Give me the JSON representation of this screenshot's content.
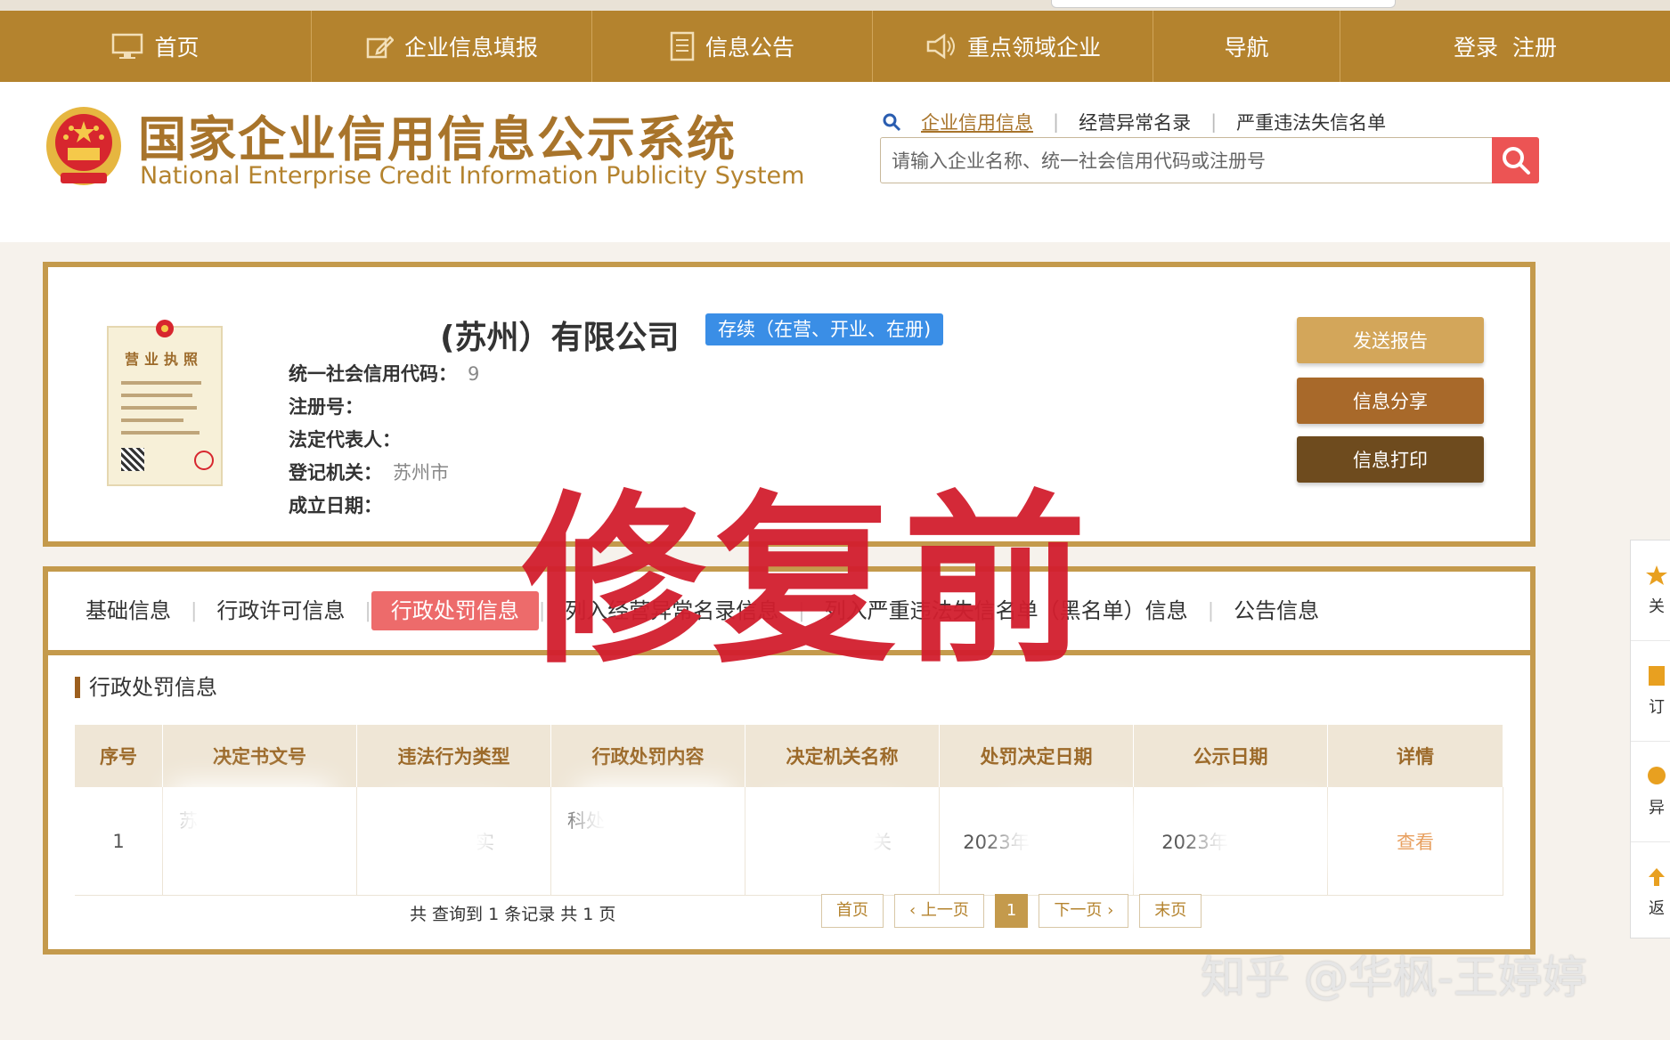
{
  "nav": {
    "items": [
      {
        "label": "首页",
        "icon": "monitor-icon"
      },
      {
        "label": "企业信息填报",
        "icon": "edit-icon"
      },
      {
        "label": "信息公告",
        "icon": "document-icon"
      },
      {
        "label": "重点领域企业",
        "icon": "speaker-icon"
      },
      {
        "label": "导航",
        "icon": ""
      },
      {
        "label": "登录  注册",
        "icon": ""
      }
    ]
  },
  "header": {
    "title_cn": "国家企业信用信息公示系统",
    "title_en": "National Enterprise Credit Information Publicity System",
    "search_links": [
      "企业信用信息",
      "经营异常名录",
      "严重违法失信名单"
    ],
    "search_placeholder": "请输入企业名称、统一社会信用代码或注册号"
  },
  "company": {
    "name": "(苏州）有限公司",
    "status": "存续（在营、开业、在册)",
    "fields": [
      {
        "label": "统一社会信用代码：",
        "value": "9"
      },
      {
        "label": "注册号：",
        "value": ""
      },
      {
        "label": "法定代表人：",
        "value": ""
      },
      {
        "label": "登记机关：",
        "value": "苏州市"
      },
      {
        "label": "成立日期：",
        "value": ""
      }
    ],
    "buttons": [
      "发送报告",
      "信息分享",
      "信息打印"
    ],
    "license_label": "营业执照"
  },
  "tabs": [
    "基础信息",
    "行政许可信息",
    "行政处罚信息",
    "列入经营异常名录信息",
    "列入严重违法失信名单（黑名单）信息",
    "公告信息"
  ],
  "active_tab": "行政处罚信息",
  "section_title": "行政处罚信息",
  "table": {
    "headers": [
      "序号",
      "决定书文号",
      "违法行为类型",
      "行政处罚内容",
      "决定机关名称",
      "处罚决定日期",
      "公示日期",
      "详情"
    ],
    "rows": [
      {
        "no": "1",
        "doc": "苏",
        "type": "实",
        "content": "科处",
        "authority": "关",
        "decision_date": "2023年",
        "publish_date": "2023年",
        "detail": "查看"
      }
    ]
  },
  "pagination": {
    "summary": "共 查询到 1 条记录 共 1 页",
    "first": "首页",
    "prev": "上一页",
    "current": "1",
    "next": "下一页",
    "last": "末页"
  },
  "overlay_text": "修复前",
  "watermark": "知乎 @华枫-王婷婷",
  "float_bar": [
    "关",
    "订",
    "异",
    "返"
  ],
  "colors": {
    "nav_bg": "#b4832e",
    "brand_gold": "#c49a4c",
    "active_tab": "#ed6b6b",
    "status_badge": "#3a8ee6",
    "search_btn": "#ec5454",
    "btn_send": "#d3a65a",
    "btn_share": "#a8692a",
    "btn_print": "#6e4b1e",
    "overlay": "#d21e2e"
  }
}
